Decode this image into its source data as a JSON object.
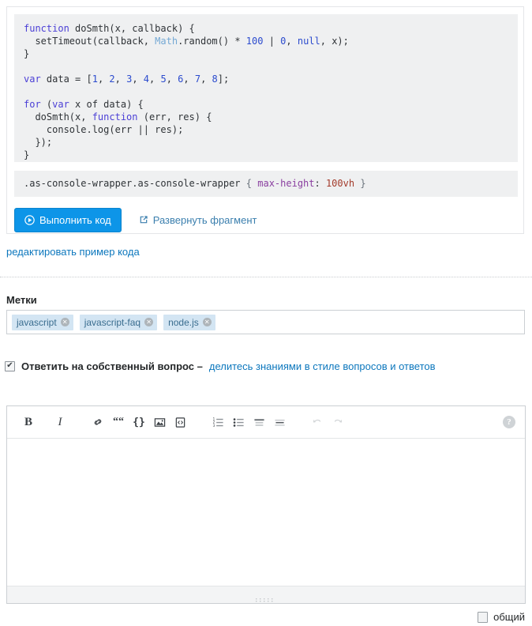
{
  "snippet": {
    "js_code_lines": [
      "function doSmth(x, callback) {",
      "  setTimeout(callback, Math.random() * 100 | 0, null, x);",
      "}",
      "",
      "var data = [1, 2, 3, 4, 5, 6, 7, 8];",
      "",
      "for (var x of data) {",
      "  doSmth(x, function (err, res) {",
      "    console.log(err || res);",
      "  });",
      "}"
    ],
    "css_code": ".as-console-wrapper.as-console-wrapper { max-height: 100vh }",
    "css_parts": {
      "selector": ".as-console-wrapper.as-console-wrapper",
      "brace_open": "{",
      "property": "max-height",
      "colon": ":",
      "value": "100vh",
      "brace_close": "}"
    },
    "run_button_label": "Выполнить код",
    "run_button_icon": "play-circle-icon",
    "expand_link_label": "Развернуть фрагмент",
    "expand_link_icon": "external-link-icon",
    "edit_example_link": "редактировать пример кода",
    "accent_blue": "#0d95e8",
    "code_bg": "#eff0f1"
  },
  "tags_section": {
    "heading": "Метки",
    "tags": [
      {
        "name": "javascript",
        "remove_icon": "close-x-icon"
      },
      {
        "name": "javascript-faq",
        "remove_icon": "close-x-icon"
      },
      {
        "name": "node.js",
        "remove_icon": "close-x-icon"
      }
    ],
    "tag_bg": "#d3e5f3",
    "tag_color": "#3a6d8f"
  },
  "own_question": {
    "checked": true,
    "label_bold": "Ответить на собственный вопрос –",
    "label_link": "делитесь знаниями в стиле вопросов и ответов",
    "link_color": "#0c77bd"
  },
  "editor": {
    "toolbar": [
      {
        "name": "bold-icon",
        "glyph": "B"
      },
      {
        "name": "italic-icon",
        "glyph": "I"
      },
      {
        "name": "link-icon",
        "glyph": "link"
      },
      {
        "name": "blockquote-icon",
        "glyph": "“"
      },
      {
        "name": "inline-code-icon",
        "glyph": "{}"
      },
      {
        "name": "image-icon",
        "glyph": "image"
      },
      {
        "name": "code-snippet-icon",
        "glyph": "snippet"
      },
      {
        "name": "ordered-list-icon",
        "glyph": "ol"
      },
      {
        "name": "unordered-list-icon",
        "glyph": "ul"
      },
      {
        "name": "heading-icon",
        "glyph": "h"
      },
      {
        "name": "horizontal-rule-icon",
        "glyph": "hr"
      },
      {
        "name": "undo-icon",
        "glyph": "undo"
      },
      {
        "name": "redo-icon",
        "glyph": "redo"
      }
    ],
    "help_icon": "help-circle-icon",
    "body_value": "",
    "body_placeholder": "",
    "resize_handle_icon": "resize-grip-icon"
  },
  "footer": {
    "community_checkbox_checked": false,
    "community_label": "общий"
  }
}
